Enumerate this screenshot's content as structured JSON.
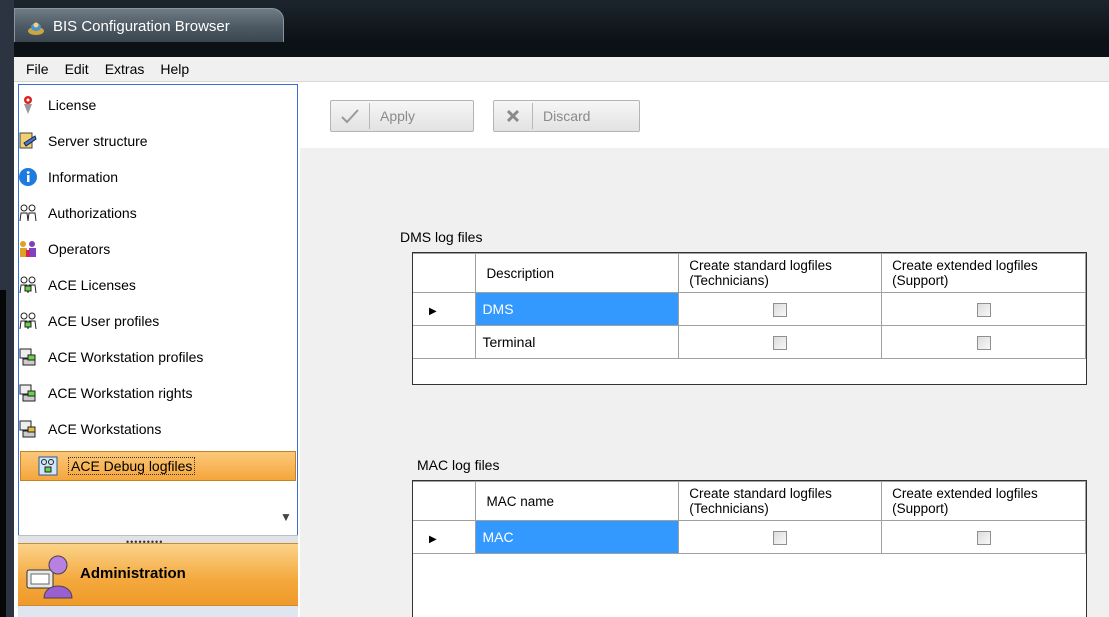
{
  "window": {
    "title": "BIS Configuration Browser"
  },
  "menu": [
    "File",
    "Edit",
    "Extras",
    "Help"
  ],
  "nav": {
    "items": [
      {
        "label": "License",
        "icon": "medal-icon"
      },
      {
        "label": "Server structure",
        "icon": "server-structure-icon"
      },
      {
        "label": "Information",
        "icon": "info-icon"
      },
      {
        "label": "Authorizations",
        "icon": "authorizations-icon"
      },
      {
        "label": "Operators",
        "icon": "operators-icon"
      },
      {
        "label": "ACE Licenses",
        "icon": "ace-licenses-icon"
      },
      {
        "label": "ACE User profiles",
        "icon": "ace-user-profiles-icon"
      },
      {
        "label": "ACE Workstation profiles",
        "icon": "workstation-profiles-icon"
      },
      {
        "label": "ACE Workstation rights",
        "icon": "workstation-rights-icon"
      },
      {
        "label": "ACE Workstations",
        "icon": "workstations-icon"
      },
      {
        "label": "ACE Debug logfiles",
        "icon": "debug-logfiles-icon",
        "selected": true
      }
    ],
    "module": "Administration"
  },
  "toolbar": {
    "apply": "Apply",
    "discard": "Discard"
  },
  "dms": {
    "title": "DMS log files",
    "columns": [
      "Description",
      "Create standard logfiles (Technicians)",
      "Create extended logfiles (Support)"
    ],
    "rows": [
      {
        "name": "DMS",
        "standard": false,
        "extended": false,
        "selected": true
      },
      {
        "name": "Terminal",
        "standard": false,
        "extended": false,
        "selected": false
      }
    ]
  },
  "mac": {
    "title": "MAC log files",
    "columns": [
      "MAC name",
      "Create standard logfiles (Technicians)",
      "Create extended logfiles (Support)"
    ],
    "rows": [
      {
        "name": "MAC",
        "standard": false,
        "extended": false,
        "selected": true
      }
    ]
  },
  "colors": {
    "selection": "#3399ff",
    "nav_selected": "#f6a63b",
    "titlebar": "#0c1116"
  }
}
